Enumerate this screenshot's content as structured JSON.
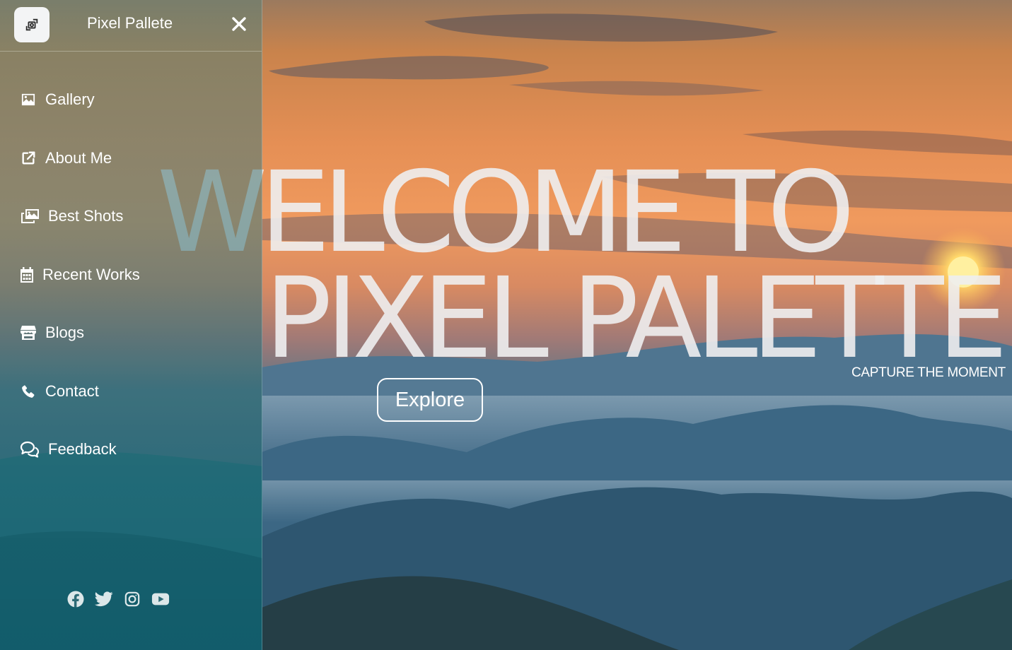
{
  "brand": {
    "name": "Pixel Pallete",
    "logo_icon": "camera-rotate-icon",
    "close_icon": "close-icon"
  },
  "nav": {
    "items": [
      {
        "label": "Gallery",
        "icon": "image-icon"
      },
      {
        "label": "About Me",
        "icon": "external-link-icon"
      },
      {
        "label": "Best Shots",
        "icon": "photos-icon"
      },
      {
        "label": "Recent Works",
        "icon": "calendar-icon"
      },
      {
        "label": "Blogs",
        "icon": "store-icon"
      },
      {
        "label": "Contact",
        "icon": "phone-icon"
      },
      {
        "label": "Feedback",
        "icon": "chat-bubbles-icon"
      }
    ]
  },
  "social": [
    {
      "name": "facebook-icon"
    },
    {
      "name": "twitter-icon"
    },
    {
      "name": "instagram-icon"
    },
    {
      "name": "youtube-icon"
    }
  ],
  "hero": {
    "headline_line1": "WELCOME TO",
    "headline_line2": "PIXEL PALETTE",
    "tagline": "CAPTURE THE MOMENT",
    "cta_label": "Explore",
    "background": "sunset-over-misty-mountains"
  },
  "colors": {
    "sky_top": "#c8793f",
    "sky_glow": "#f0995c",
    "mountain_blue": "#2f5f78",
    "sidebar_tint": "#1d6f7a",
    "text": "#ffffff"
  }
}
